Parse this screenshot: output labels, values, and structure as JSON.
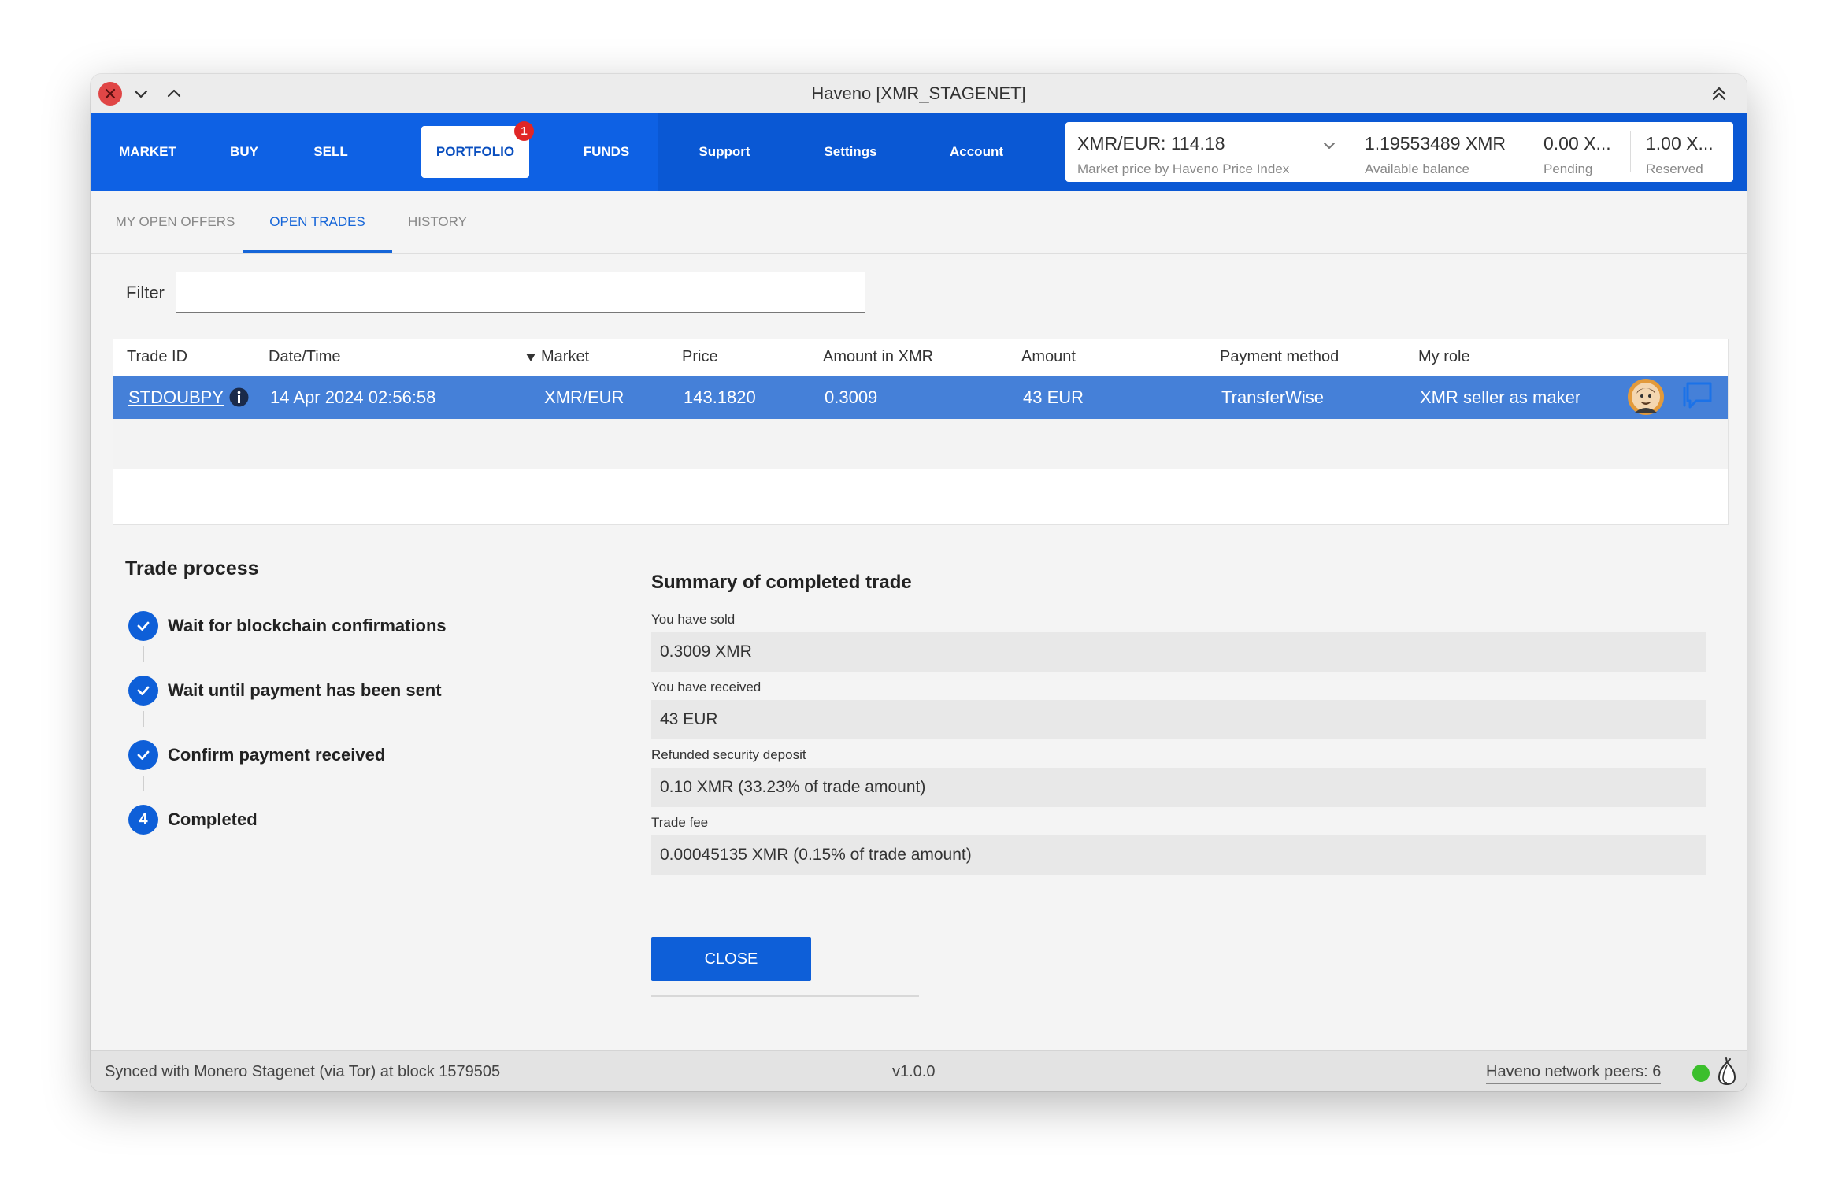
{
  "window": {
    "title": "Haveno [XMR_STAGENET]"
  },
  "nav": {
    "tabs": [
      {
        "label": "MARKET"
      },
      {
        "label": "BUY"
      },
      {
        "label": "SELL"
      },
      {
        "label": "PORTFOLIO",
        "badge": "1"
      },
      {
        "label": "FUNDS"
      },
      {
        "label": "Support"
      },
      {
        "label": "Settings"
      },
      {
        "label": "Account"
      }
    ],
    "market_price": {
      "value": "XMR/EUR: 114.18",
      "label": "Market price by Haveno Price Index"
    },
    "available": {
      "value": "1.19553489 XMR",
      "label": "Available balance"
    },
    "pending": {
      "value": "0.00 X...",
      "label": "Pending"
    },
    "reserved": {
      "value": "1.00 X...",
      "label": "Reserved"
    }
  },
  "subtabs": [
    {
      "label": "MY OPEN OFFERS"
    },
    {
      "label": "OPEN TRADES"
    },
    {
      "label": "HISTORY"
    }
  ],
  "filter": {
    "label": "Filter",
    "value": ""
  },
  "table": {
    "headers": [
      "Trade ID",
      "Date/Time",
      "Market",
      "Price",
      "Amount in XMR",
      "Amount",
      "Payment method",
      "My role"
    ],
    "rows": [
      {
        "trade_id": "STDOUBPY",
        "datetime": "14 Apr 2024 02:56:58",
        "market": "XMR/EUR",
        "price": "143.1820",
        "amount_xmr": "0.3009",
        "amount": "43 EUR",
        "payment_method": "TransferWise",
        "role": "XMR seller as maker"
      }
    ]
  },
  "trade_process": {
    "title": "Trade process",
    "steps": [
      {
        "label": "Wait for blockchain confirmations",
        "done": true
      },
      {
        "label": "Wait until payment has been sent",
        "done": true
      },
      {
        "label": "Confirm payment received",
        "done": true
      },
      {
        "label": "Completed",
        "number": "4"
      }
    ]
  },
  "summary": {
    "title": "Summary of completed trade",
    "fields": [
      {
        "label": "You have sold",
        "value": "0.3009 XMR"
      },
      {
        "label": "You have received",
        "value": "43 EUR"
      },
      {
        "label": "Refunded security deposit",
        "value": "0.10 XMR (33.23% of trade amount)"
      },
      {
        "label": "Trade fee",
        "value": "0.00045135 XMR (0.15% of trade amount)"
      }
    ],
    "close_label": "CLOSE"
  },
  "footer": {
    "sync": "Synced with Monero Stagenet (via Tor) at block 1579505",
    "version": "v1.0.0",
    "peers": "Haveno network peers: 6"
  },
  "colors": {
    "accent": "#0e61e4",
    "selected_row": "#4580d8",
    "badge": "#e02626",
    "online": "#3bbf2c"
  }
}
